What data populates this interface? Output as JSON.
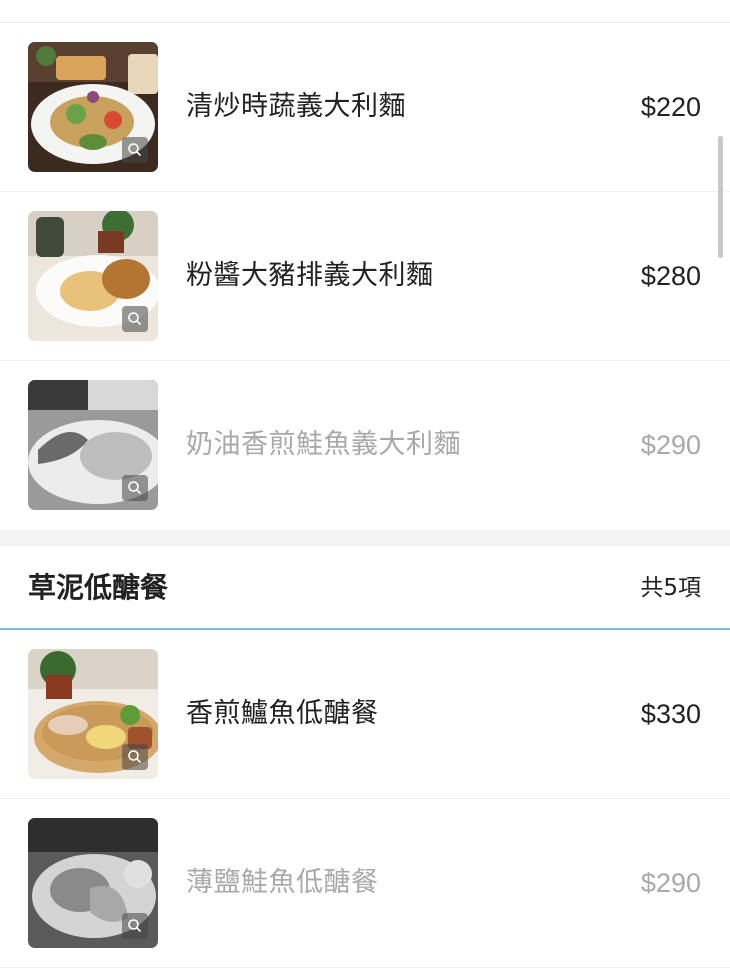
{
  "menu": {
    "pasta_items": [
      {
        "name": "清炒時蔬義大利麵",
        "price": "$220",
        "available": true
      },
      {
        "name": "粉醬大豬排義大利麵",
        "price": "$280",
        "available": true
      },
      {
        "name": "奶油香煎鮭魚義大利麵",
        "price": "$290",
        "available": false
      }
    ],
    "section": {
      "title": "草泥低醣餐",
      "count": "共5項"
    },
    "lowcarb_items": [
      {
        "name": "香煎鱸魚低醣餐",
        "price": "$330",
        "available": true
      },
      {
        "name": "薄鹽鮭魚低醣餐",
        "price": "$290",
        "available": false
      }
    ]
  },
  "colors": {
    "text": "#222222",
    "sold_out_text": "#a9a9a9",
    "section_divider": "#7ebfd8",
    "gap_background": "#f4f4f4"
  }
}
